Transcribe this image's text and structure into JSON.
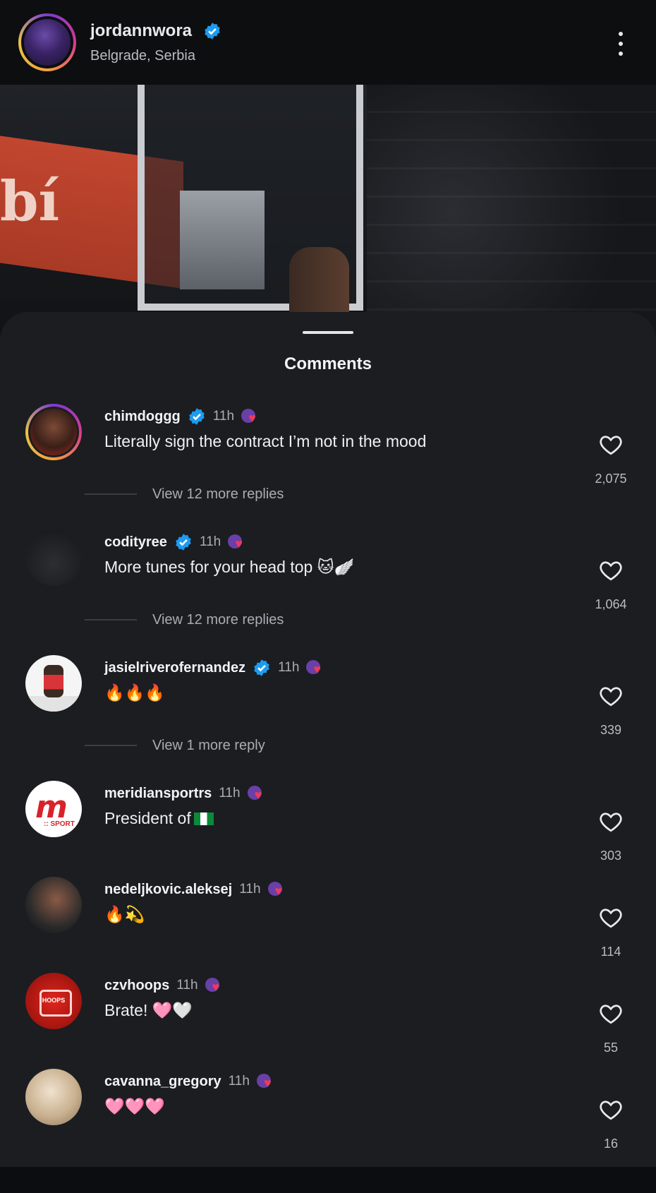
{
  "header": {
    "username": "jordannwora",
    "location": "Belgrade, Serbia"
  },
  "sheet": {
    "title": "Comments"
  },
  "comments": [
    {
      "username": "chimdoggg",
      "verified": true,
      "time": "11h",
      "text": "Literally sign the contract I’m not in the mood",
      "likes": "2,075",
      "replies": "View 12 more replies"
    },
    {
      "username": "codityree",
      "verified": true,
      "time": "11h",
      "text": "More tunes for your head top 🐱🪽",
      "likes": "1,064",
      "replies": "View 12 more replies"
    },
    {
      "username": "jasielriverofernandez",
      "verified": true,
      "time": "11h",
      "text": "🔥🔥🔥",
      "likes": "339",
      "replies": "View 1 more reply"
    },
    {
      "username": "meridiansportrs",
      "verified": false,
      "time": "11h",
      "text": "President of",
      "likes": "303",
      "replies": ""
    },
    {
      "username": "nedeljkovic.aleksej",
      "verified": false,
      "time": "11h",
      "text": "🔥💫",
      "likes": "114",
      "replies": ""
    },
    {
      "username": "czvhoops",
      "verified": false,
      "time": "11h",
      "text": "Brate! 🩷🤍",
      "likes": "55",
      "replies": ""
    },
    {
      "username": "cavanna_gregory",
      "verified": false,
      "time": "11h",
      "text": "🩷🩷🩷",
      "likes": "16",
      "replies": ""
    }
  ],
  "avatars": {
    "meridian_letter": "m",
    "meridian_sub": ":: SPORT",
    "czv_logo": "HOOPS"
  },
  "photo": {
    "banner_text": "bí"
  },
  "colors": {
    "sheet_bg": "#1b1d21",
    "verified": "#1d9bf0",
    "heart_accent": "#f03a55"
  },
  "icons": {
    "verified": "verified-badge-icon",
    "more": "more-options-icon",
    "like": "heart-outline-icon",
    "creator_like": "creator-liked-heart-icon",
    "flag": "nigeria-flag-icon"
  }
}
